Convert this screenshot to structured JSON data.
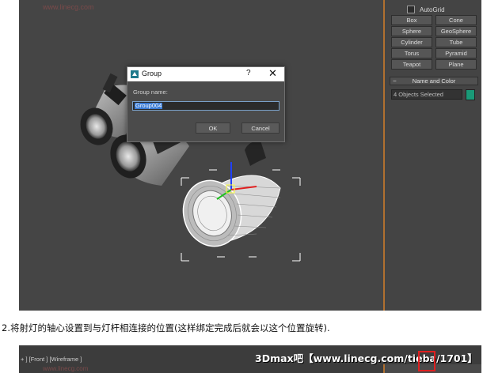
{
  "panel": {
    "autogrid_label": "AutoGrid",
    "primitives": [
      "Box",
      "Cone",
      "Sphere",
      "GeoSphere",
      "Cylinder",
      "Tube",
      "Torus",
      "Pyramid",
      "Teapot",
      "Plane"
    ],
    "name_color_header": "Name and Color",
    "name_color_collapse": "−",
    "name_field_value": "4 Objects Selected",
    "color_swatch": "#1a9a78"
  },
  "dialog": {
    "title": "Group",
    "help": "?",
    "close": "✕",
    "group_name_label": "Group name:",
    "group_name_value": "Group004",
    "ok_label": "OK",
    "cancel_label": "Cancel"
  },
  "caption": "2.将射灯的轴心设置到与灯杆相连接的位置(这样绑定完成后就会以这个位置旋转).",
  "second_shot": {
    "viewport_label": "+ ] [Front ] [Wireframe ]",
    "banner": "3Dmax吧【www.linecg.com/tieba/1701】"
  },
  "colors": {
    "viewport_bg": "#454545",
    "panel_accent": "#b07030",
    "selection_blue": "#3a7bd5",
    "highlight_red": "#e02020"
  }
}
